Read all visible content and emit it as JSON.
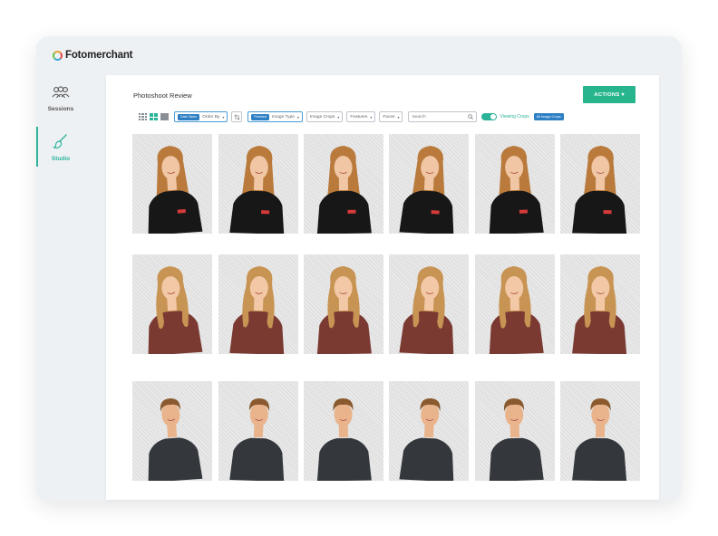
{
  "brand": {
    "name": "Fotomerchant"
  },
  "sidebar": {
    "items": [
      {
        "label": "Sessions",
        "icon": "users-icon",
        "active": false
      },
      {
        "label": "Studio",
        "icon": "brush-icon",
        "active": true
      }
    ]
  },
  "page": {
    "title": "Photoshoot Review"
  },
  "actions": {
    "label": "ACTIONS ▾"
  },
  "toolbar": {
    "view_modes": [
      "grid-small-icon",
      "grid-medium-icon",
      "grid-large-icon"
    ],
    "active_view": 1,
    "order": {
      "tag": "Date Taken",
      "label": "Order By"
    },
    "image_type": {
      "tag": "Finished",
      "label": "Image Type"
    },
    "image_crops": "Image Crops",
    "features": "Features",
    "faces": "Faces",
    "search": {
      "placeholder": "Search"
    },
    "viewing_crops": "Viewing Crops",
    "all_crops": "All Image Crops"
  },
  "colors": {
    "accent": "#2bb39a",
    "actions_button": "#27b58e",
    "tag_blue": "#2d7fc4",
    "frame_bg": "#eef1f4"
  },
  "gallery": {
    "rows": [
      {
        "subject": "girl-black-shirt",
        "count": 6
      },
      {
        "subject": "girl-red-top",
        "count": 6
      },
      {
        "subject": "boy-dark-shirt",
        "count": 6
      }
    ]
  }
}
